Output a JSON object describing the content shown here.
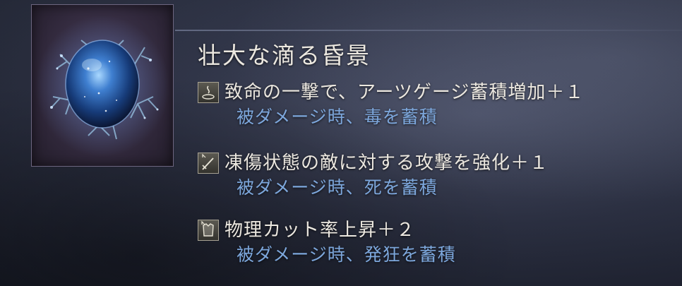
{
  "item": {
    "title": "壮大な滴る昏景",
    "image_icon": "blue-orb-with-coral-branches"
  },
  "effects": [
    {
      "icon": "arts-gauge-icon",
      "text": "致命の一撃で、アーツゲージ蓄積増加＋１",
      "drawback": "被ダメージ時、毒を蓄積"
    },
    {
      "icon": "sword-icon",
      "text": "凍傷状態の敵に対する攻撃を強化＋１",
      "drawback": "被ダメージ時、死を蓄積"
    },
    {
      "icon": "armor-icon",
      "text": "物理カット率上昇＋２",
      "drawback": "被ダメージ時、発狂を蓄積"
    }
  ],
  "colors": {
    "effect_text": "#ece8e0",
    "drawback_text": "#7da7dc",
    "frame_border": "#6d6680"
  }
}
